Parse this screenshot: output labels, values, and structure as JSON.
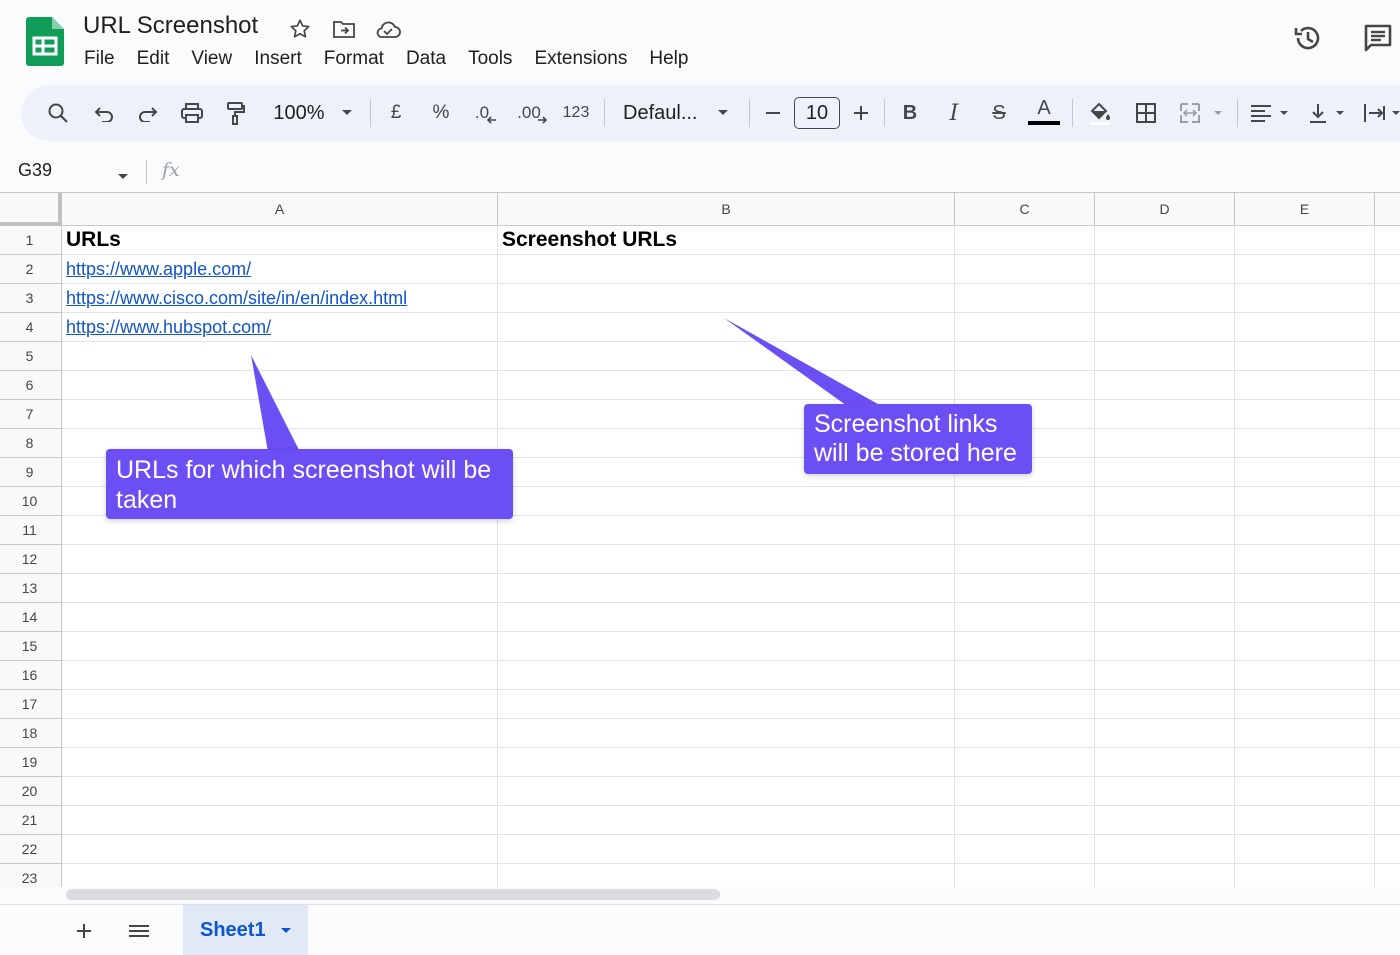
{
  "app": {
    "doc_title": "URL Screenshot",
    "brand_color": "#0f9d58"
  },
  "menu": [
    "File",
    "Edit",
    "View",
    "Insert",
    "Format",
    "Data",
    "Tools",
    "Extensions",
    "Help"
  ],
  "toolbar": {
    "zoom": "100%",
    "currency": "£",
    "percent": "%",
    "decrease_decimal": ".0",
    "increase_decimal": ".00",
    "more_formats": "123",
    "font": "Defaul...",
    "font_size": "10",
    "bold": "B",
    "italic": "I",
    "strike": "S",
    "text_color": "A"
  },
  "formula_bar": {
    "name_box": "G39",
    "fx": "fx"
  },
  "columns": [
    "A",
    "B",
    "C",
    "D",
    "E"
  ],
  "rows": [
    "1",
    "2",
    "3",
    "4",
    "5",
    "6",
    "7",
    "8",
    "9",
    "10",
    "11",
    "12",
    "13",
    "14",
    "15",
    "16",
    "17",
    "18",
    "19",
    "20",
    "21",
    "22",
    "23"
  ],
  "cells": {
    "A1": "URLs",
    "B1": "Screenshot URLs",
    "A2": "https://www.apple.com/",
    "A3": "https://www.cisco.com/site/in/en/index.html",
    "A4": "https://www.hubspot.com/"
  },
  "callouts": {
    "left": "URLs for which screenshot will be taken",
    "right_line1": "Screenshot links",
    "right_line2": "will be stored here",
    "color": "#6c4ef5"
  },
  "sheets": {
    "active": "Sheet1"
  }
}
